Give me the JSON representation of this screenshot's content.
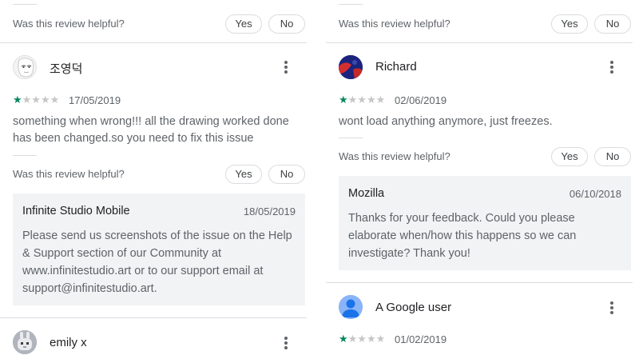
{
  "helpful": {
    "question": "Was this review helpful?",
    "yes": "Yes",
    "no": "No"
  },
  "left": {
    "review1": {
      "author": "조영덕",
      "rating": 1,
      "date": "17/05/2019",
      "text": "something when wrong!!! all the drawing worked done has been changed.so you need to fix this issue",
      "reply": {
        "author": "Infinite Studio Mobile",
        "date": "18/05/2019",
        "text": "Please send us screenshots of the issue on the Help & Support section of our Community at www.infinitestudio.art or to our support email at support@infinitestudio.art."
      }
    },
    "review2": {
      "author": "emily x"
    }
  },
  "right": {
    "review1": {
      "author": "Richard",
      "rating": 1,
      "date": "02/06/2019",
      "text": "wont load anything anymore, just freezes.",
      "reply": {
        "author": "Mozilla",
        "date": "06/10/2018",
        "text": "Thanks for your feedback. Could you please elaborate when/how this happens so we can investigate? Thank you!"
      }
    },
    "review2": {
      "author": "A Google user",
      "rating": 1,
      "date": "01/02/2019"
    }
  },
  "icons": {
    "more": "more-vert-icon",
    "star": "star-icon",
    "avatar_generic": "person-icon"
  },
  "colors": {
    "star_filled": "#01875f",
    "star_empty": "#c6c6c6",
    "reply_bg": "#f1f3f4",
    "richard_avatar": "#1a237e",
    "google_user_avatar": "#8ab4f8"
  }
}
